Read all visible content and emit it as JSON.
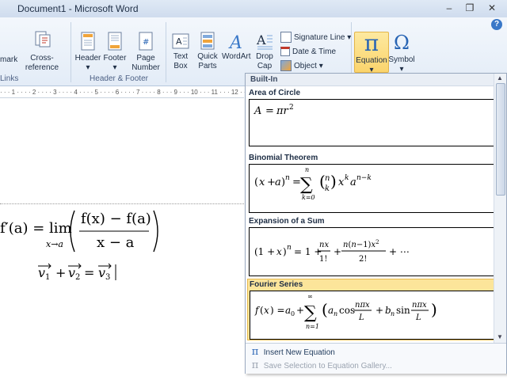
{
  "window": {
    "title": "Document1 - Microsoft Word",
    "minimize": "–",
    "restore": "❐",
    "close": "✕",
    "help": "?"
  },
  "ribbon": {
    "links_group": {
      "bookmark": "mark",
      "cross_reference": "Cross-reference",
      "label": "Links"
    },
    "header_footer_group": {
      "header": "Header",
      "footer": "Footer",
      "page_number": "Page\nNumber",
      "label": "Header & Footer"
    },
    "text_group": {
      "text_box": "Text\nBox",
      "quick_parts": "Quick\nParts",
      "wordart": "WordArt",
      "drop_cap": "Drop\nCap",
      "signature_line": "Signature Line",
      "date_time": "Date & Time",
      "object": "Object"
    },
    "symbols_group": {
      "equation": "Equation",
      "symbol": "Symbol"
    }
  },
  "ruler": {
    "ticks": "·  ·  ·  1  ·  ·  ·  ·  2  ·  ·  ·  ·  3  ·  ·  ·  ·  4  ·  ·  ·  ·  5  ·  ·  ·  ·  6  ·  ·  ·  ·  7  ·  ·  ·  ·  8  ·  ·  ·  9  ·  ·  ·  10  ·  ·  ·  11  ·  ·  ·  12  ·  ·  ·"
  },
  "document": {
    "eq1_prefix": "f′(a) = lim",
    "eq1_sub": "x→a",
    "eq1_num": "f(x) − f(a)",
    "eq1_den": "x − a"
  },
  "gallery": {
    "header": "Built-In",
    "items": [
      {
        "label": "Area of Circle"
      },
      {
        "label": "Binomial Theorem"
      },
      {
        "label": "Expansion of a Sum"
      },
      {
        "label": "Fourier Series"
      }
    ],
    "insert_new": "Insert New Equation",
    "save_selection": "Save Selection to Equation Gallery..."
  },
  "colors": {
    "accent": "#2864b4",
    "selected": "#fce59a",
    "ribbon_text": "#1e2e45"
  }
}
